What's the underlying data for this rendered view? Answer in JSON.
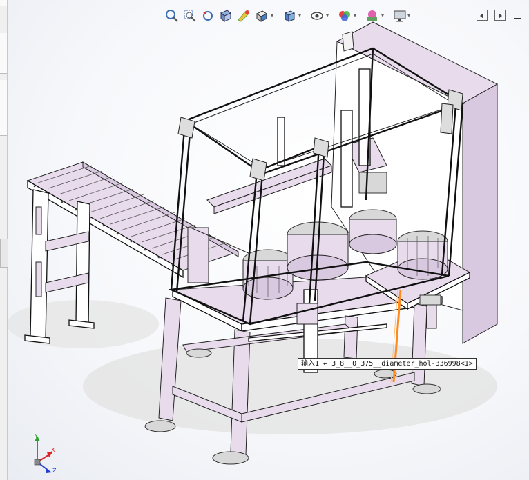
{
  "toolbar": {
    "items": [
      {
        "icon": "zoom-to-fit-icon"
      },
      {
        "icon": "zoom-to-area-icon"
      },
      {
        "icon": "previous-view-icon"
      },
      {
        "icon": "section-view-icon"
      },
      {
        "icon": "dynamic-annotation-icon"
      },
      {
        "icon": "view-orientation-icon"
      },
      {
        "icon": "display-style-icon"
      },
      {
        "icon": "hide-show-items-icon"
      },
      {
        "icon": "edit-appearance-icon"
      },
      {
        "icon": "apply-scene-icon"
      },
      {
        "icon": "view-settings-icon"
      }
    ],
    "right": [
      {
        "icon": "restore-left-icon"
      },
      {
        "icon": "restore-right-icon"
      },
      {
        "icon": "minimize-icon"
      }
    ]
  },
  "callout": {
    "prefix": "输入1",
    "arrow": "←",
    "reference": "3_8__0_375__diameter_hol-336998<1>"
  },
  "triad": {
    "x_label": "X",
    "y_label": "Y",
    "z_label": "Z"
  },
  "colors": {
    "frame": "#ffffff",
    "panel": "#e8dcec",
    "highlight": "#ff8a1e",
    "axis_x": "#e02020",
    "axis_y": "#2aa02a",
    "axis_z": "#2040d0"
  }
}
